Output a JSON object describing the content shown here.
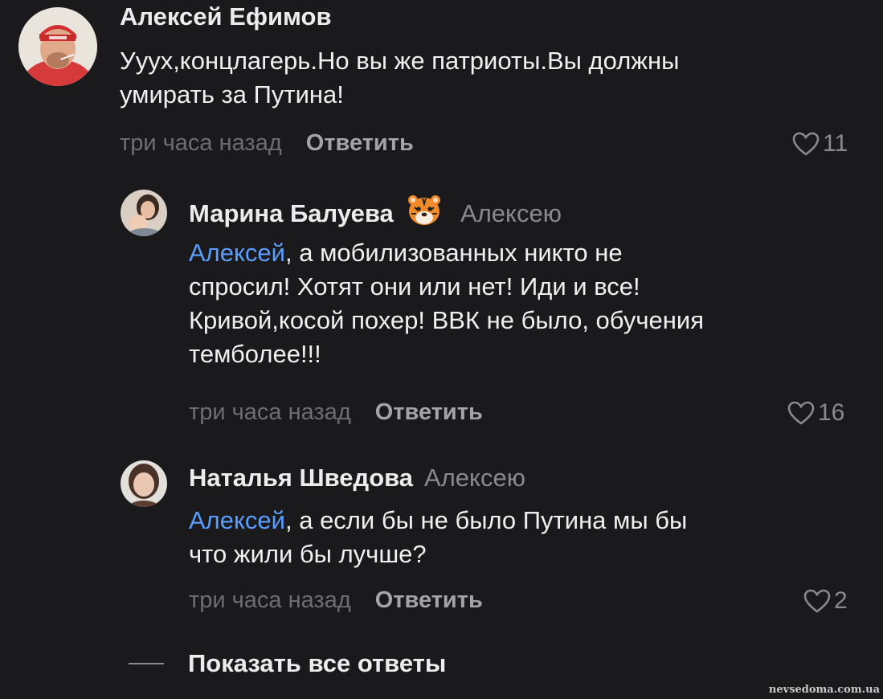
{
  "comments": [
    {
      "author": "Алексей Ефимов",
      "reply_to": "",
      "mention": "",
      "text_parts": [
        "Ууух,концлагерь.Но вы же патриоты.Вы должны",
        "умирать за Путина!"
      ],
      "time": "три часа назад",
      "reply_label": "Ответить",
      "likes": "11"
    },
    {
      "author": "Марина Балуева",
      "reply_to": "Алексею",
      "mention": "Алексей",
      "text_parts": [
        ", а мобилизованных никто не",
        "спросил! Хотят они или нет! Иди и все!",
        "Кривой,косой похер! ВВК не было, обучения",
        "темболее!!!"
      ],
      "time": "три часа назад",
      "reply_label": "Ответить",
      "likes": "16"
    },
    {
      "author": "Наталья Шведова",
      "reply_to": "Алексею",
      "mention": "Алексей",
      "text_parts": [
        ", а если бы не было Путина мы бы",
        "что жили бы лучше?"
      ],
      "time": "три часа назад",
      "reply_label": "Ответить",
      "likes": "2"
    }
  ],
  "show_all_label": "Показать все ответы",
  "watermark": "nevsedoma.com.ua",
  "colors": {
    "background": "#1a1a1c",
    "mention": "#5b9dff",
    "meta": "#6d6d72"
  }
}
